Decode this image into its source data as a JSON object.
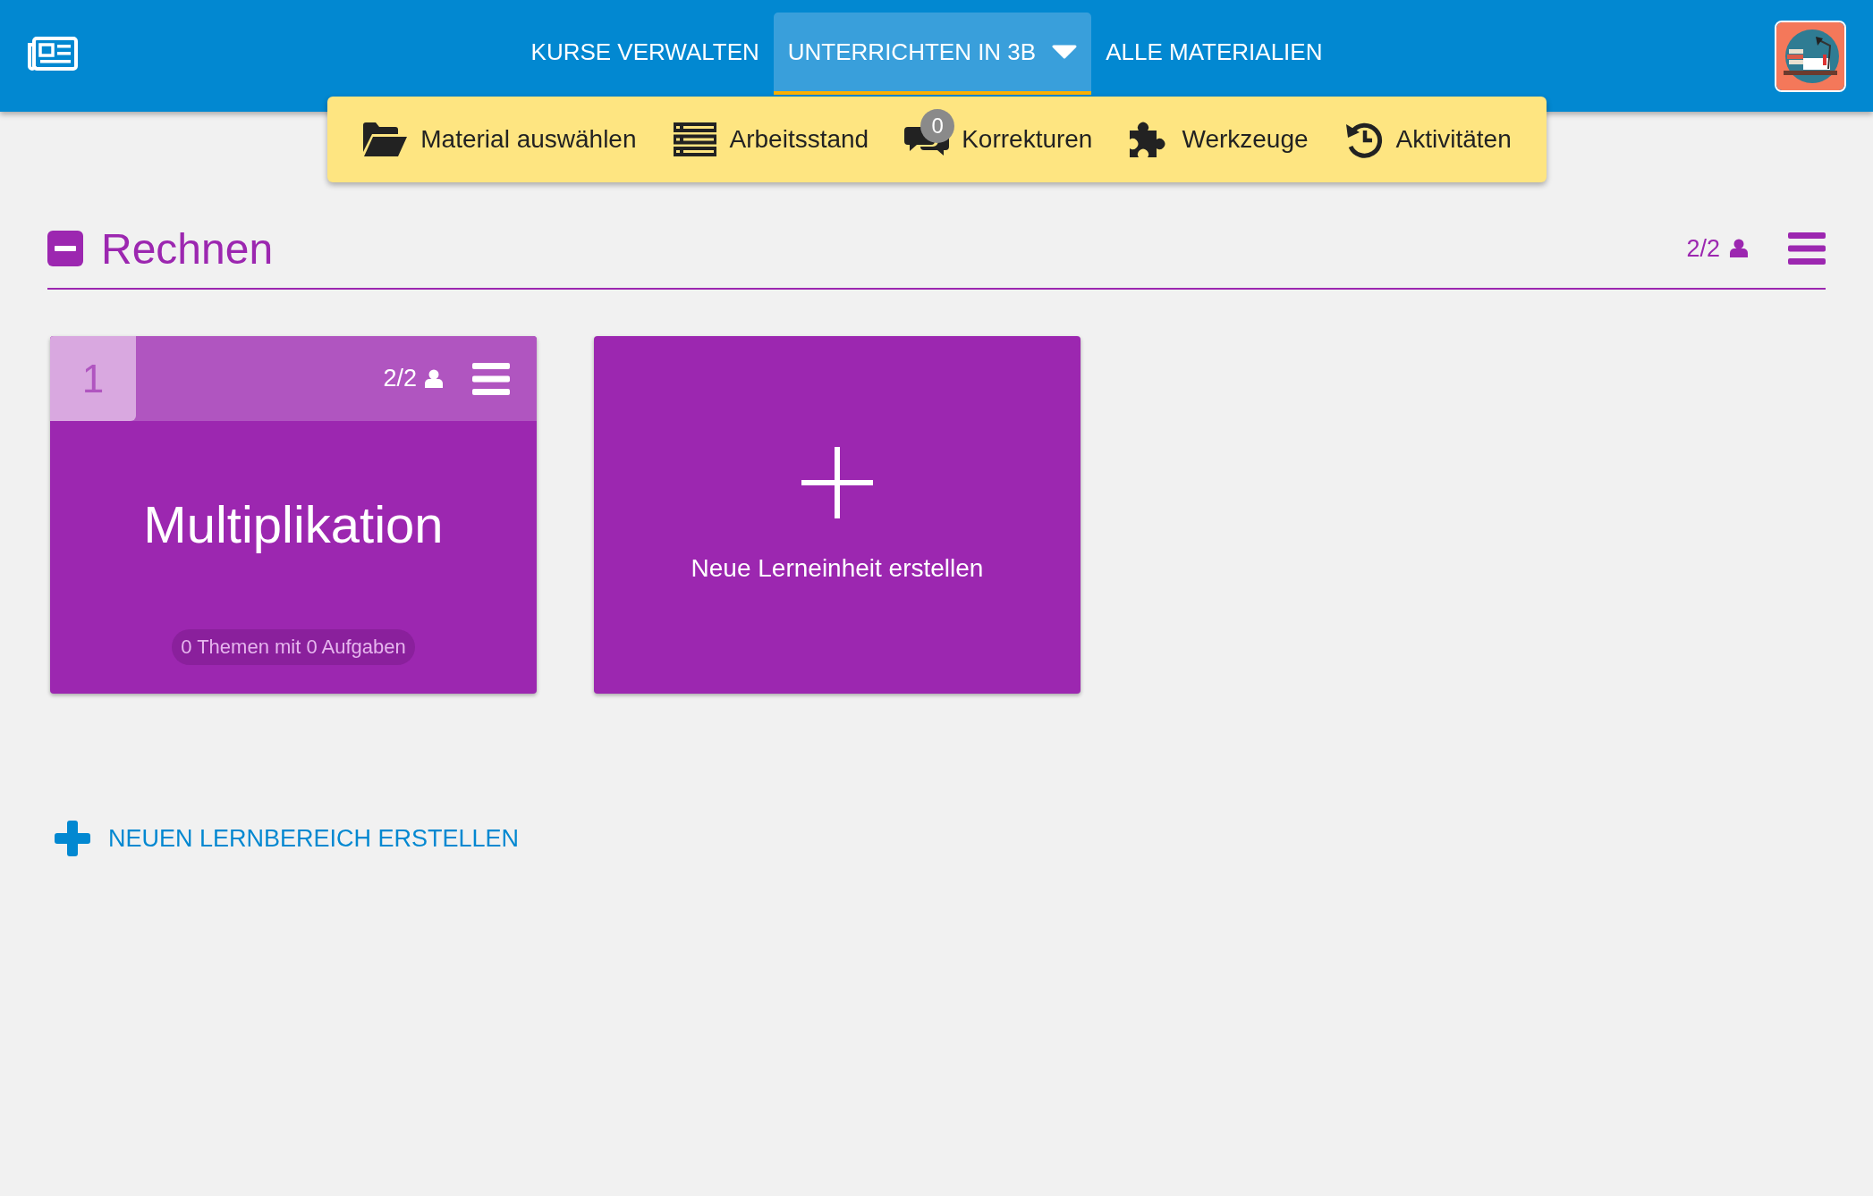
{
  "header": {
    "nav": [
      {
        "label": "KURSE VERWALTEN",
        "selected": false,
        "dropdown": false
      },
      {
        "label": "UNTERRICHTEN IN 3B",
        "selected": true,
        "dropdown": true
      },
      {
        "label": "ALLE MATERIALIEN",
        "selected": false,
        "dropdown": false
      }
    ]
  },
  "toolbar": {
    "items": [
      {
        "kind": "folder",
        "label": "Material auswählen"
      },
      {
        "kind": "list",
        "label": "Arbeitsstand"
      },
      {
        "kind": "comments",
        "label": "Korrekturen",
        "badge": "0"
      },
      {
        "kind": "puzzle",
        "label": "Werkzeuge"
      },
      {
        "kind": "history",
        "label": "Aktivitäten"
      }
    ]
  },
  "section": {
    "title": "Rechnen",
    "expanded": true,
    "participants": "2/2",
    "units": [
      {
        "number": "1",
        "participants": "2/2",
        "title": "Multiplikation",
        "summary": "0 Themen mit 0 Aufgaben"
      }
    ],
    "new_unit": "Neue Lerneinheit erstellen"
  },
  "new_area": "NEUEN LERNBEREICH ERSTELLEN"
}
